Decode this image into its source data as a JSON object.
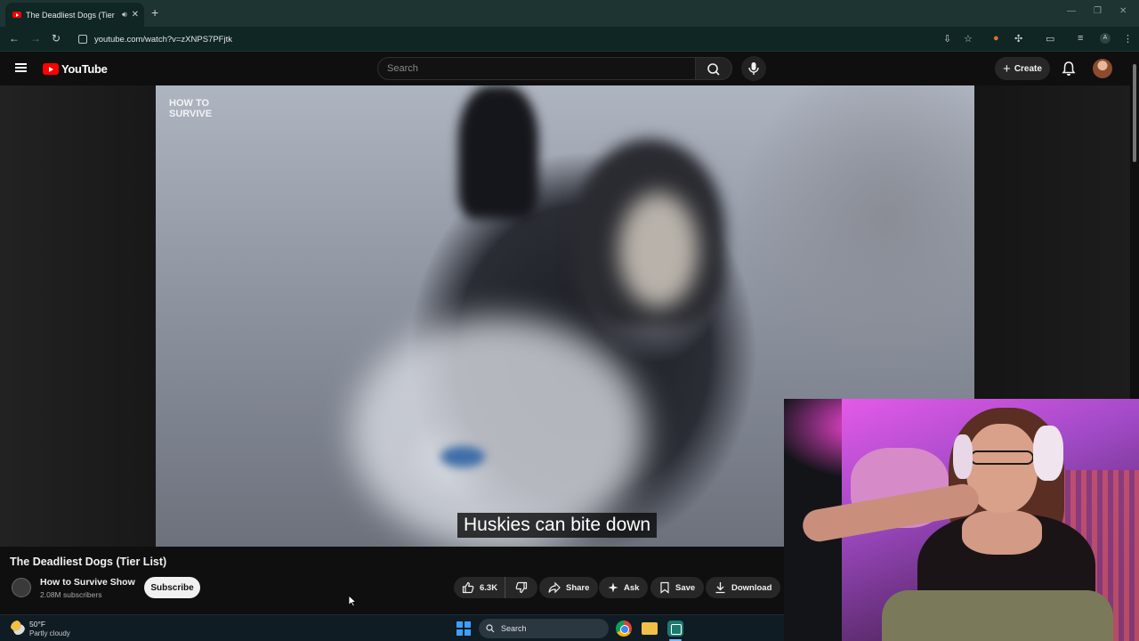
{
  "browser": {
    "tab_title": "The Deadliest Dogs (Tier Li",
    "url": "youtube.com/watch?v=zXNPS7PFjtk",
    "profile_initial": "A"
  },
  "youtube": {
    "logo_text": "YouTube",
    "search_placeholder": "Search",
    "create_label": "Create"
  },
  "video": {
    "watermark_line1": "HOW TO",
    "watermark_line2": "SURVIVE",
    "caption": "Huskies can bite down",
    "title": "The Deadliest Dogs (Tier List)",
    "channel_name": "How to Survive Show",
    "subscribers": "2.08M subscribers",
    "subscribe_label": "Subscribe",
    "likes": "6.3K",
    "share_label": "Share",
    "ask_label": "Ask",
    "save_label": "Save",
    "download_label": "Download"
  },
  "taskbar": {
    "temperature": "50°F",
    "weather": "Partly cloudy",
    "search_label": "Search"
  },
  "colors": {
    "youtube_red": "#ff0000",
    "page_bg": "#0f0f0f",
    "browser_chrome": "#0f2624"
  }
}
